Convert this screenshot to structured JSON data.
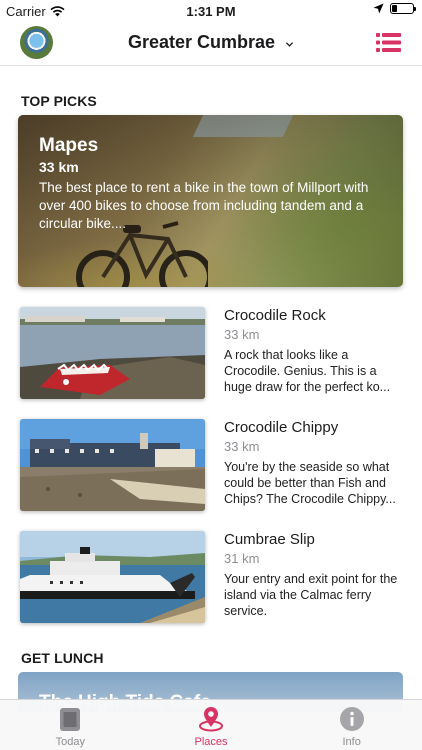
{
  "status_bar": {
    "carrier": "Carrier",
    "time": "1:31 PM",
    "battery_level": 0.25
  },
  "header": {
    "title": "Greater Cumbrae",
    "menu_icon": "list-menu-icon",
    "accent_color": "#d83463"
  },
  "top_picks": {
    "section_title": "TOP PICKS",
    "featured": {
      "name": "Mapes",
      "distance": "33 km",
      "description": "The best place to rent a bike in the town of Millport with over 400 bikes to choose from including tandem and a circular bike...."
    },
    "items": [
      {
        "name": "Crocodile Rock",
        "distance": "33 km",
        "description": "A rock that looks like a Crocodile. Genius. This is a huge draw for the perfect ko..."
      },
      {
        "name": "Crocodile Chippy",
        "distance": "33 km",
        "description": "You're by the seaside so what could be better than Fish and Chips? The Crocodile Chippy..."
      },
      {
        "name": "Cumbrae Slip",
        "distance": "31 km",
        "description": "Your entry and exit point for the island via the Calmac ferry service."
      }
    ]
  },
  "get_lunch": {
    "section_title": "GET LUNCH",
    "featured_name": "The High Tide Cafe"
  },
  "tab_bar": {
    "tabs": [
      {
        "label": "Today",
        "icon": "today-icon",
        "active": false
      },
      {
        "label": "Places",
        "icon": "map-pin-icon",
        "active": true
      },
      {
        "label": "Info",
        "icon": "info-icon",
        "active": false
      }
    ]
  }
}
